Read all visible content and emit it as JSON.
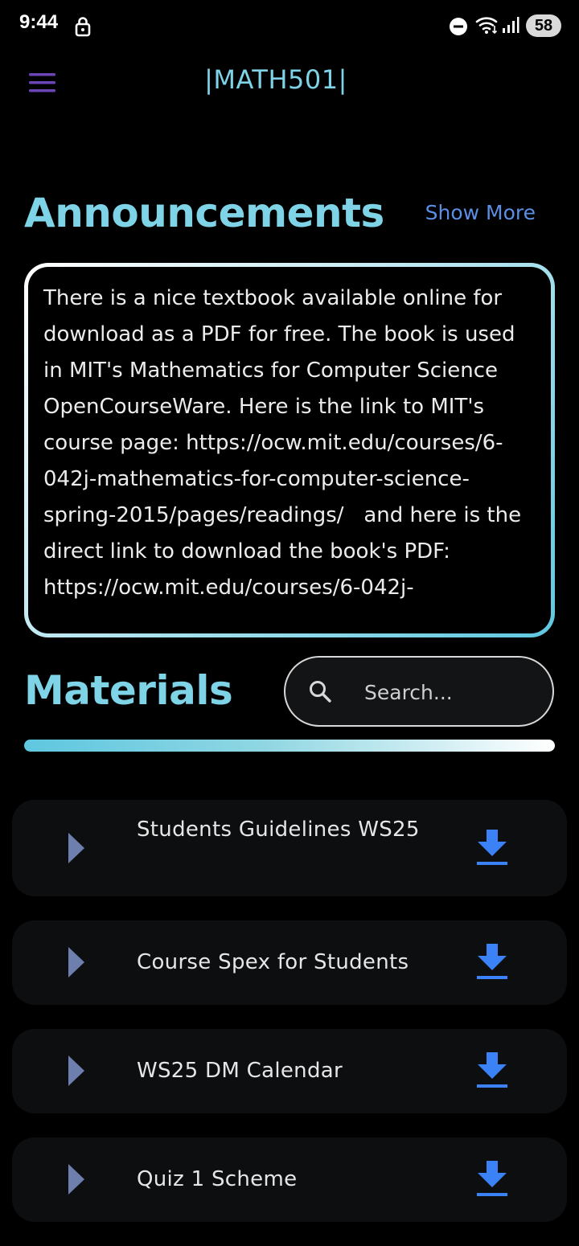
{
  "status_bar": {
    "time": "9:44",
    "battery": "58"
  },
  "app_bar": {
    "title": "|MATH501|"
  },
  "announcements": {
    "heading": "Announcements",
    "show_more_label": "Show More",
    "text": "There is a nice textbook available online for download as a PDF for free. The book is used in MIT's Mathematics for Computer Science OpenCourseWare. Here is the link to MIT's course page: https://ocw.mit.edu/courses/6-042j-mathematics-for-computer-science-spring-2015/pages/readings/   and here is the direct link to download the book's PDF: https://ocw.mit.edu/courses/6-042j-"
  },
  "materials": {
    "heading": "Materials",
    "search_placeholder": "Search...",
    "items": [
      {
        "label": "Students Guidelines WS25"
      },
      {
        "label": "Course Spex for Students"
      },
      {
        "label": "WS25 DM Calendar"
      },
      {
        "label": "Quiz 1 Scheme"
      }
    ]
  },
  "colors": {
    "accent": "#7ed3e6",
    "link": "#5b8fe6",
    "download": "#3b82f6",
    "arrow": "#6e7fae",
    "menu": "#6b44b5",
    "card_bg": "#0d0e10"
  },
  "icons": {
    "menu": "hamburger-menu-icon",
    "search": "search-icon",
    "arrow": "play-arrow-icon",
    "download": "download-icon"
  }
}
